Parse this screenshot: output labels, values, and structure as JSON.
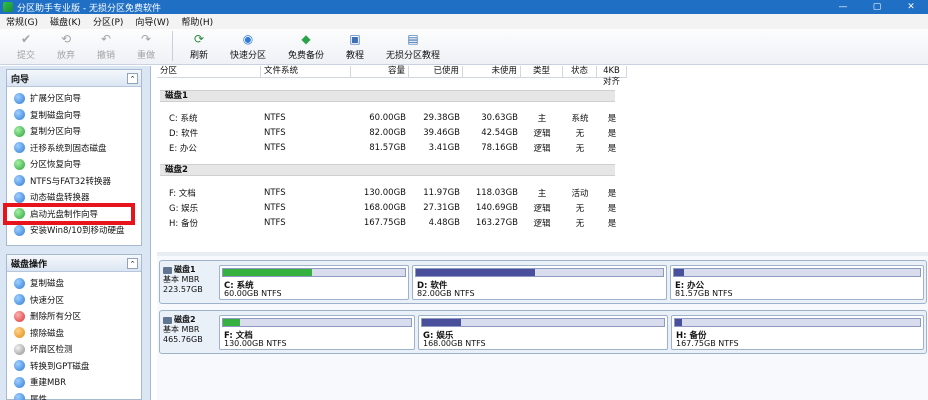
{
  "window": {
    "title": "分区助手专业版 - 无损分区免费软件",
    "min": "—",
    "max": "▢",
    "close": "✕"
  },
  "menu": [
    "常规(G)",
    "磁盘(K)",
    "分区(P)",
    "向导(W)",
    "帮助(H)"
  ],
  "toolbar": {
    "items": [
      {
        "label": "提交",
        "icon": "✔",
        "enabled": false
      },
      {
        "label": "放弃",
        "icon": "⟲",
        "enabled": false
      },
      {
        "label": "撤销",
        "icon": "↶",
        "enabled": false
      },
      {
        "label": "重做",
        "icon": "↷",
        "enabled": false
      },
      {
        "label": "刷新",
        "icon": "⟳",
        "enabled": true
      },
      {
        "label": "快速分区",
        "icon": "◉",
        "enabled": true
      },
      {
        "label": "免费备份",
        "icon": "◆",
        "enabled": true
      },
      {
        "label": "教程",
        "icon": "▣",
        "enabled": true
      },
      {
        "label": "无损分区教程",
        "icon": "▤",
        "enabled": true
      }
    ]
  },
  "wizard": {
    "header": "向导",
    "collapse": "⌃",
    "items": [
      "扩展分区向导",
      "复制磁盘向导",
      "复制分区向导",
      "迁移系统到固态磁盘",
      "分区恢复向导",
      "NTFS与FAT32转换器",
      "动态磁盘转换器",
      "启动光盘制作向导",
      "安装Win8/10到移动硬盘"
    ]
  },
  "disk_ops": {
    "header": "磁盘操作",
    "collapse": "⌃",
    "items": [
      "复制磁盘",
      "快速分区",
      "删除所有分区",
      "擦除磁盘",
      "坏扇区检测",
      "转换到GPT磁盘",
      "重建MBR",
      "属性"
    ]
  },
  "table": {
    "headers": [
      "分区",
      "文件系统",
      "容量",
      "已使用",
      "未使用",
      "类型",
      "状态",
      "4KB对齐"
    ],
    "disks": [
      {
        "name": "磁盘1",
        "partitions": [
          {
            "part": "C: 系统",
            "fs": "NTFS",
            "cap": "60.00GB",
            "used": "29.38GB",
            "unused": "30.63GB",
            "type": "主",
            "status": "系统",
            "align": "是"
          },
          {
            "part": "D: 软件",
            "fs": "NTFS",
            "cap": "82.00GB",
            "used": "39.46GB",
            "unused": "42.54GB",
            "type": "逻辑",
            "status": "无",
            "align": "是"
          },
          {
            "part": "E: 办公",
            "fs": "NTFS",
            "cap": "81.57GB",
            "used": "3.41GB",
            "unused": "78.16GB",
            "type": "逻辑",
            "status": "无",
            "align": "是"
          }
        ]
      },
      {
        "name": "磁盘2",
        "partitions": [
          {
            "part": "F: 文档",
            "fs": "NTFS",
            "cap": "130.00GB",
            "used": "11.97GB",
            "unused": "118.03GB",
            "type": "主",
            "status": "活动",
            "align": "是"
          },
          {
            "part": "G: 娱乐",
            "fs": "NTFS",
            "cap": "168.00GB",
            "used": "27.31GB",
            "unused": "140.69GB",
            "type": "逻辑",
            "status": "无",
            "align": "是"
          },
          {
            "part": "H: 备份",
            "fs": "NTFS",
            "cap": "167.75GB",
            "used": "4.48GB",
            "unused": "163.27GB",
            "type": "逻辑",
            "status": "无",
            "align": "是"
          }
        ]
      }
    ]
  },
  "diskmap": {
    "disks": [
      {
        "name": "磁盘1",
        "kind": "基本 MBR",
        "size": "223.57GB",
        "partitions": [
          {
            "name": "C: 系统",
            "info": "60.00GB NTFS",
            "fill": 0.49,
            "color": "#36b03e"
          },
          {
            "name": "D: 软件",
            "info": "82.00GB NTFS",
            "fill": 0.48,
            "color": "#4a4f9c"
          },
          {
            "name": "E: 办公",
            "info": "81.57GB NTFS",
            "fill": 0.04,
            "color": "#4a4f9c"
          }
        ]
      },
      {
        "name": "磁盘2",
        "kind": "基本 MBR",
        "size": "465.76GB",
        "partitions": [
          {
            "name": "F: 文档",
            "info": "130.00GB NTFS",
            "fill": 0.09,
            "color": "#36b03e"
          },
          {
            "name": "G: 娱乐",
            "info": "168.00GB NTFS",
            "fill": 0.16,
            "color": "#4a4f9c"
          },
          {
            "name": "H: 备份",
            "info": "167.75GB NTFS",
            "fill": 0.03,
            "color": "#4a4f9c"
          }
        ]
      }
    ]
  }
}
